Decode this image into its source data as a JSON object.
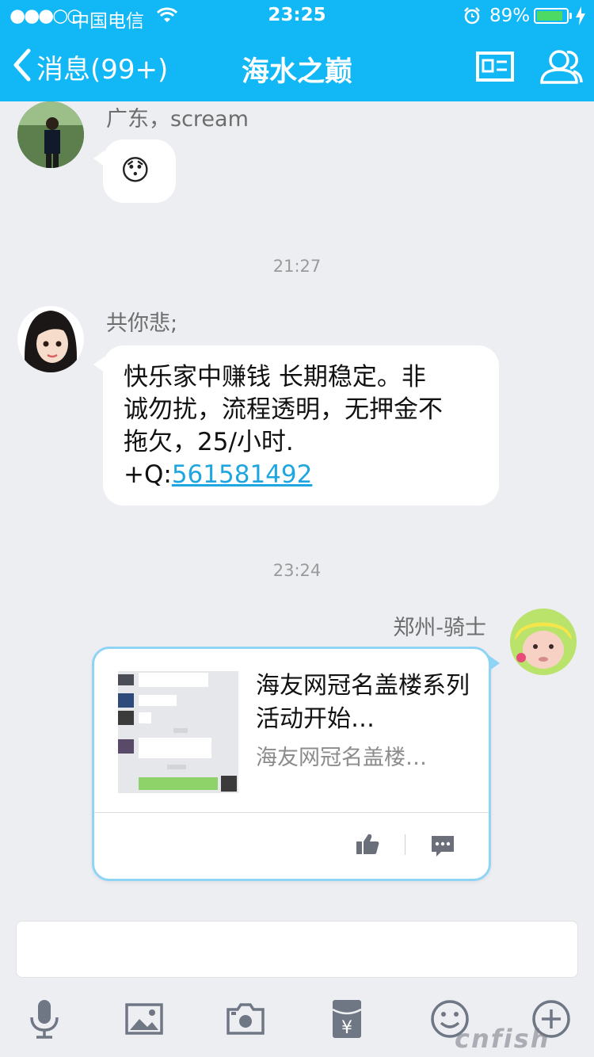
{
  "status_bar": {
    "signal": "●●●○○",
    "carrier": "中国电信",
    "time": "23:25",
    "battery_percent": "89%",
    "battery_level": 0.89
  },
  "nav": {
    "back_label": "消息(99+)",
    "title": "海水之巅"
  },
  "messages": [
    {
      "sender": "广东，scream",
      "emoji": "😯"
    },
    {
      "timestamp": "21:27"
    },
    {
      "sender": "共你悲;",
      "lines": [
        "快乐家中赚钱 长期稳定。非",
        "诚勿扰，流程透明，无押金不",
        "拖欠，25/小时."
      ],
      "link_prefix": "+Q:",
      "link": "561581492"
    },
    {
      "timestamp": "23:24"
    },
    {
      "sender": "郑州-骑士",
      "card": {
        "title": "海友网冠名盖楼系列活动开始…",
        "subtitle": "海友网冠名盖楼…"
      }
    }
  ],
  "input": {
    "value": ""
  },
  "toolbar": [
    "mic-icon",
    "image-icon",
    "camera-icon",
    "red-packet-icon",
    "emoji-icon",
    "plus-icon"
  ],
  "watermark": "cnfish",
  "colors": {
    "accent": "#12b7f5",
    "link": "#1fa6e0",
    "card_border": "#8fd4f5"
  }
}
